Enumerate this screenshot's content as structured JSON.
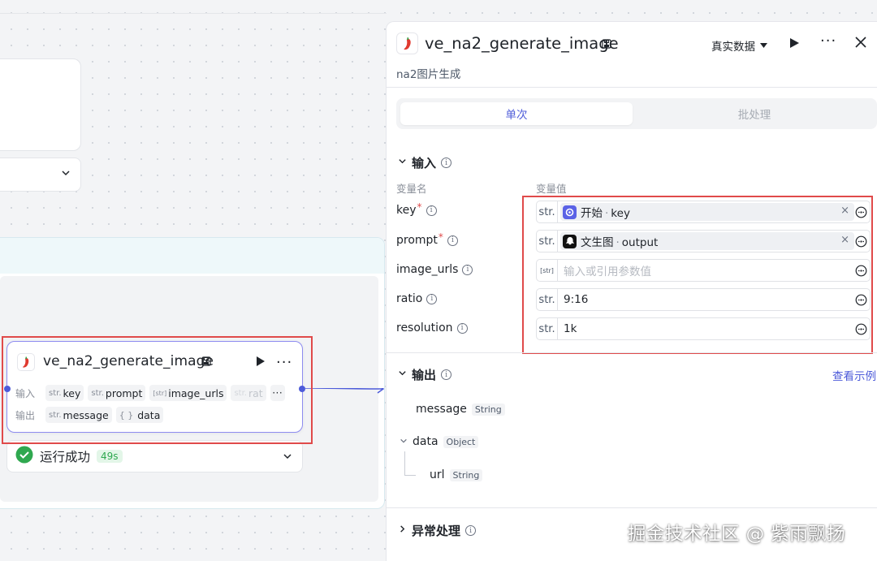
{
  "canvas": {
    "node": {
      "title": "ve_na2_generate_image",
      "inputs_label": "输入",
      "outputs_label": "输出",
      "inputs": [
        {
          "type": "str.",
          "name": "key"
        },
        {
          "type": "str.",
          "name": "prompt"
        },
        {
          "type": "[str]",
          "name": "image_urls"
        },
        {
          "type": "str.",
          "name": "rat"
        }
      ],
      "more_label": "···",
      "outputs": [
        {
          "type": "str.",
          "name": "message"
        },
        {
          "type": "{ }",
          "name": "data"
        }
      ]
    },
    "status": {
      "text": "运行成功",
      "time": "49s"
    }
  },
  "panel": {
    "title": "ve_na2_generate_image",
    "subtitle": "na2图片生成",
    "data_select": "真实数据",
    "tabs": [
      "单次",
      "批处理"
    ],
    "input_section": {
      "title": "输入",
      "col_name": "变量名",
      "col_value": "变量值",
      "vars": [
        {
          "name": "key",
          "required": "*",
          "type": "str.",
          "ref_node": "开始",
          "ref_sep": "·",
          "ref_field": "key",
          "clear": "×"
        },
        {
          "name": "prompt",
          "required": "*",
          "type": "str.",
          "ref_node": "文生图",
          "ref_sep": "·",
          "ref_field": "output",
          "clear": "×"
        },
        {
          "name": "image_urls",
          "type": "[str]",
          "placeholder": "输入或引用参数值"
        },
        {
          "name": "ratio",
          "type": "str.",
          "value": "9:16"
        },
        {
          "name": "resolution",
          "type": "str.",
          "value": "1k"
        }
      ]
    },
    "output_section": {
      "title": "输出",
      "see_example": "查看示例",
      "items": [
        {
          "name": "message",
          "type": "String"
        },
        {
          "name": "data",
          "type": "Object"
        },
        {
          "name": "url",
          "type": "String"
        }
      ]
    },
    "exception_section": {
      "title": "异常处理"
    }
  },
  "watermark": "掘金技术社区 @ 紫雨飘扬",
  "colors": {
    "accent": "#4d5bd9",
    "highlight_red": "#e04a4a",
    "success": "#2fa84f",
    "node_border": "#8e8cf0"
  },
  "icons": [
    "chili-logo-icon",
    "save-icon",
    "play-icon",
    "more-icon",
    "close-icon",
    "info-icon",
    "chevron-down-icon",
    "chevron-right-icon",
    "check-circle-icon",
    "variable-setting-icon",
    "start-node-icon",
    "text-to-image-icon"
  ]
}
